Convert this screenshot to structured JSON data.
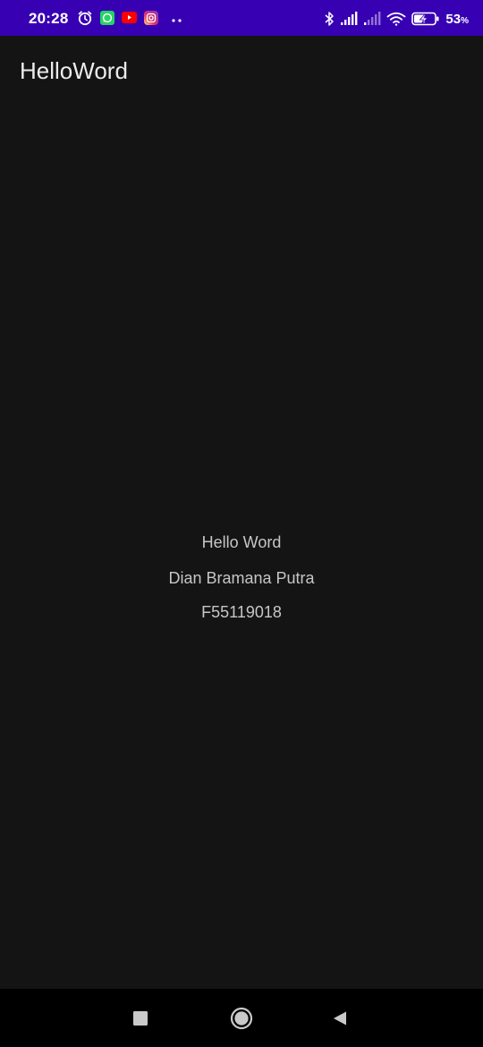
{
  "status_bar": {
    "time": "20:28",
    "battery_percent": "53",
    "battery_unit": "%",
    "notification_icons": [
      "alarm-icon",
      "whatsapp-icon",
      "youtube-icon",
      "instagram-icon",
      "more-dots-icon"
    ],
    "system_icons": [
      "bluetooth-icon",
      "signal-icon",
      "signal-2-icon",
      "wifi-icon",
      "battery-charging-icon"
    ],
    "colors": {
      "background": "#3700b3",
      "whatsapp": "#25d366",
      "youtube": "#ff0000",
      "instagram": "#e1306c"
    }
  },
  "app_bar": {
    "title": "HelloWord"
  },
  "main": {
    "greeting": "Hello Word",
    "name": "Dian Bramana Putra",
    "student_id": "F55119018"
  },
  "nav_bar": {
    "buttons": [
      "recents-icon",
      "home-icon",
      "back-icon"
    ]
  },
  "colors": {
    "background": "#141414",
    "title_text": "#ececec",
    "body_text": "#c6c6c6",
    "nav_bar": "#000000"
  }
}
